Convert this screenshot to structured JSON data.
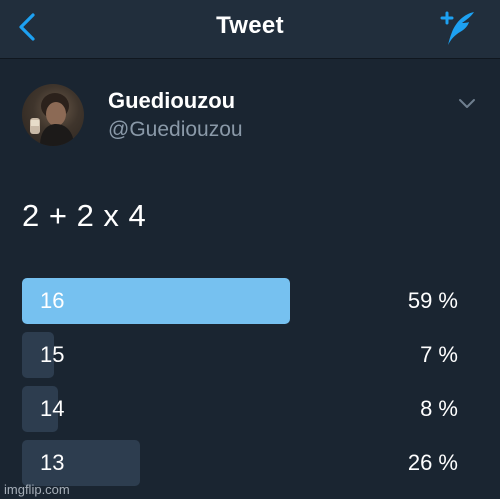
{
  "navbar": {
    "title": "Tweet",
    "back_icon": "chevron-left-icon",
    "compose_icon": "compose-tweet-icon"
  },
  "tweet": {
    "author_name": "Guediouzou",
    "author_handle": "@Guediouzou",
    "text": "2 + 2 x 4"
  },
  "poll": {
    "options": [
      {
        "label": "16",
        "percent_text": "59 %",
        "percent": 59,
        "winner": true
      },
      {
        "label": "15",
        "percent_text": "7 %",
        "percent": 7,
        "winner": false
      },
      {
        "label": "14",
        "percent_text": "8 %",
        "percent": 8,
        "winner": false
      },
      {
        "label": "13",
        "percent_text": "26 %",
        "percent": 26,
        "winner": false
      }
    ]
  },
  "colors": {
    "background": "#1a2531",
    "navbar": "#212e3c",
    "accent": "#1da1f2",
    "winner_bar": "#76c1f0",
    "bar": "#2d3d4f",
    "handle": "#8a99a8"
  },
  "watermark": "imgflip.com"
}
